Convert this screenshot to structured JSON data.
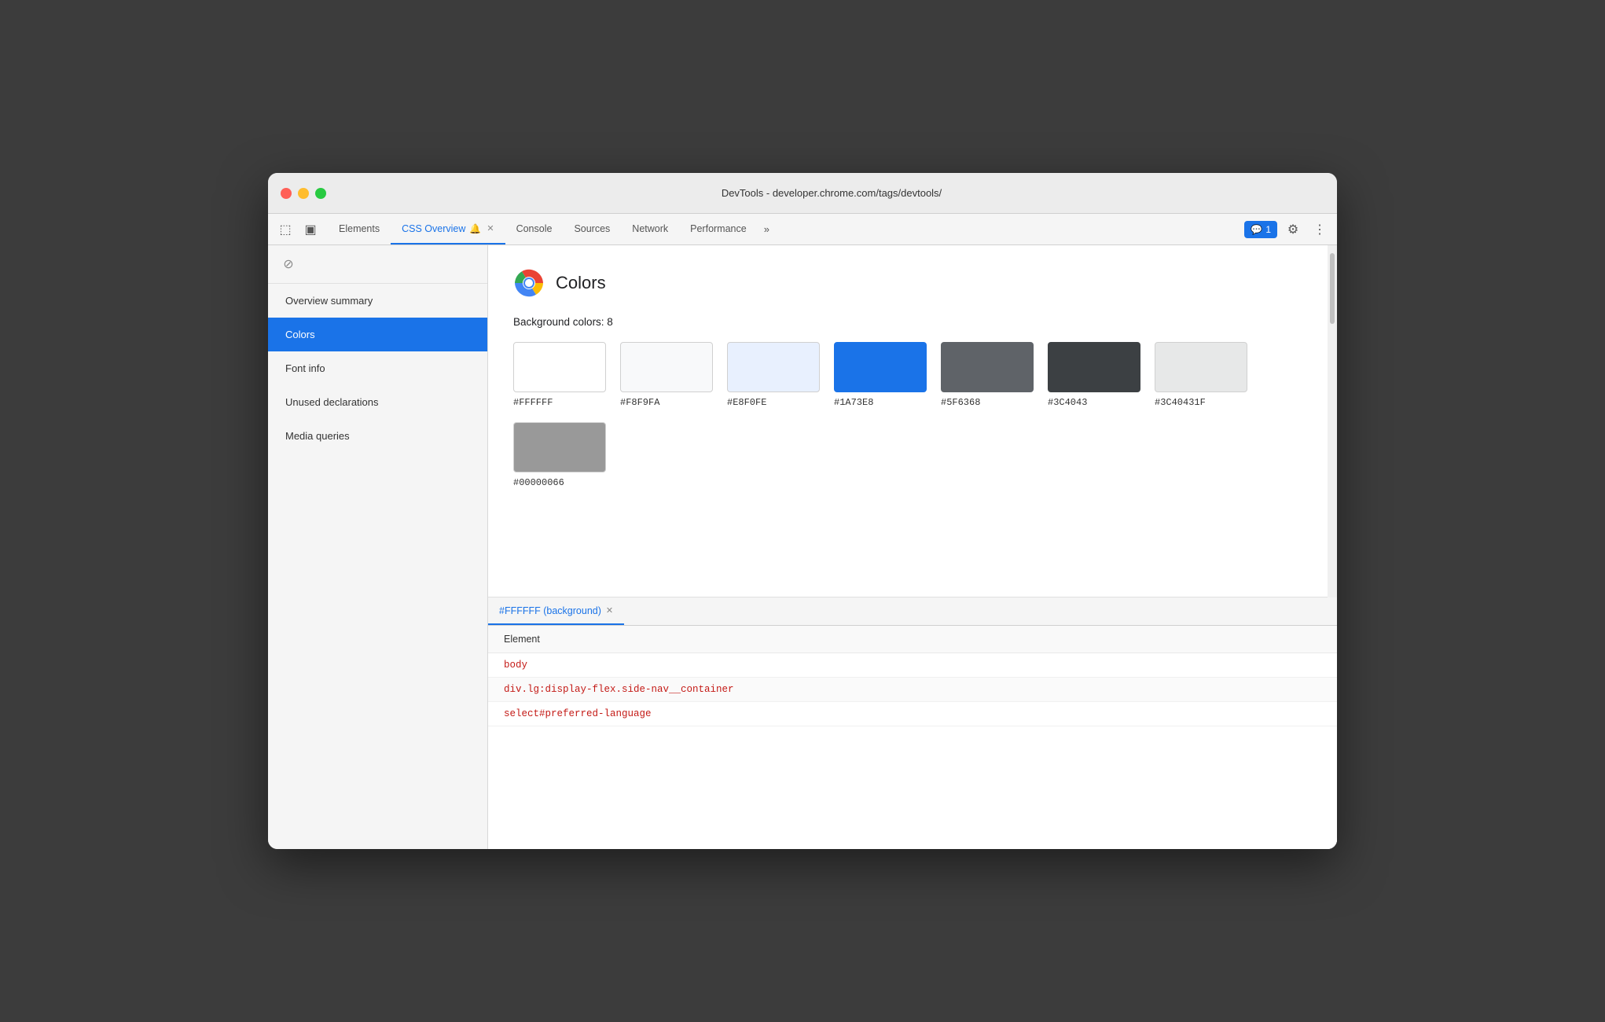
{
  "window": {
    "title": "DevTools - developer.chrome.com/tags/devtools/"
  },
  "tabs": {
    "items": [
      {
        "label": "Elements",
        "active": false,
        "closeable": false
      },
      {
        "label": "CSS Overview",
        "active": true,
        "closeable": true,
        "has_icon": true
      },
      {
        "label": "Console",
        "active": false,
        "closeable": false
      },
      {
        "label": "Sources",
        "active": false,
        "closeable": false
      },
      {
        "label": "Network",
        "active": false,
        "closeable": false
      },
      {
        "label": "Performance",
        "active": false,
        "closeable": false
      }
    ],
    "more_label": "»",
    "chat_label": "💬 1"
  },
  "sidebar": {
    "items": [
      {
        "label": "Overview summary",
        "active": false
      },
      {
        "label": "Colors",
        "active": true
      },
      {
        "label": "Font info",
        "active": false
      },
      {
        "label": "Unused declarations",
        "active": false
      },
      {
        "label": "Media queries",
        "active": false
      }
    ]
  },
  "colors_section": {
    "title": "Colors",
    "bg_colors_label": "Background colors: 8",
    "colors": [
      {
        "hex": "#FFFFFF",
        "bg": "#FFFFFF",
        "border": true
      },
      {
        "hex": "#F8F9FA",
        "bg": "#F8F9FA",
        "border": true
      },
      {
        "hex": "#E8F0FE",
        "bg": "#E8F0FE",
        "border": true
      },
      {
        "hex": "#1A73E8",
        "bg": "#1A73E8",
        "border": false
      },
      {
        "hex": "#5F6368",
        "bg": "#5F6368",
        "border": false
      },
      {
        "hex": "#3C4043",
        "bg": "#3C4043",
        "border": false
      },
      {
        "hex": "#3C40431F",
        "bg": "#e8e8e8",
        "border": true
      },
      {
        "hex": "#00000066",
        "bg": "rgba(0,0,0,0.4)",
        "border": true
      }
    ]
  },
  "bottom_panel": {
    "tab_label": "#FFFFFF (background)",
    "element_header": "Element",
    "elements": [
      {
        "text": "body",
        "color": "red"
      },
      {
        "text": "div.lg:display-flex.side-nav__container",
        "color": "red"
      },
      {
        "text": "select#preferred-language",
        "color": "red"
      }
    ]
  }
}
